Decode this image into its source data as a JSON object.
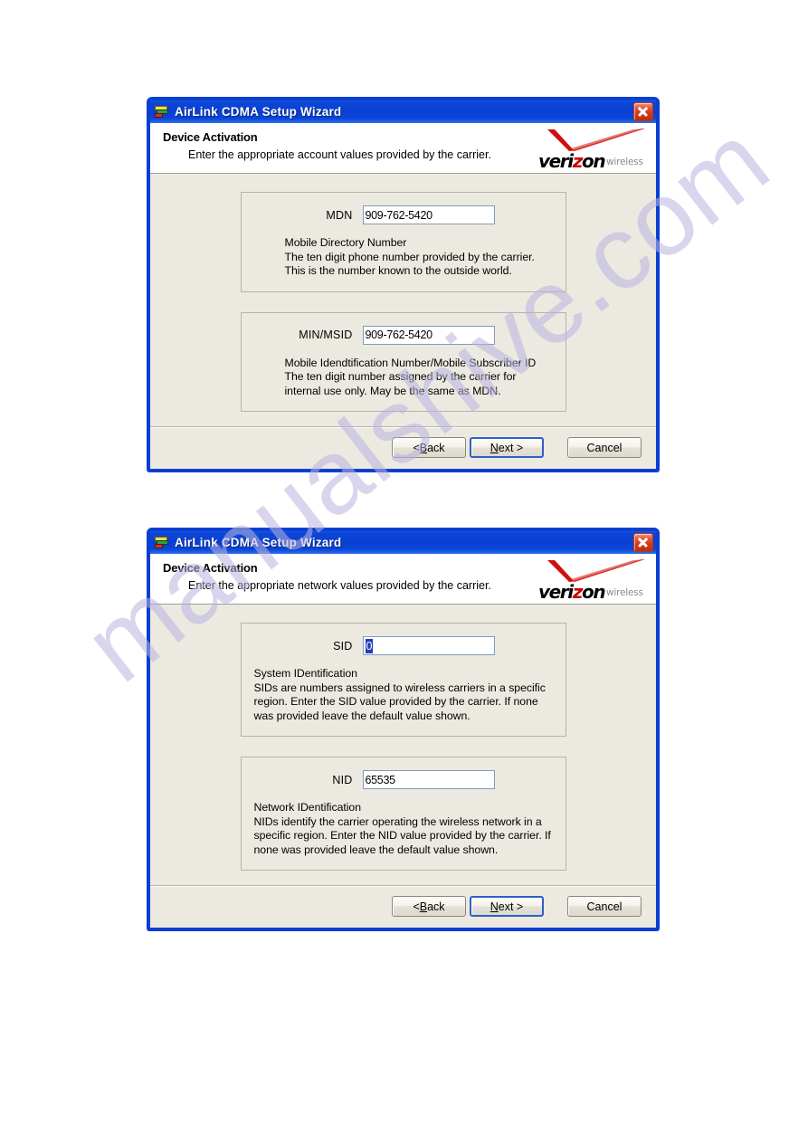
{
  "page": {
    "watermark": "manualshive.com",
    "watermark_color": "#b9b4e0",
    "background": "#ffffff"
  },
  "theme": {
    "titlebar_blue": "#0a3fd4",
    "body_beige": "#ece9e0",
    "header_white": "#ffffff",
    "input_border": "#7f9db9",
    "selection_blue": "#1f3fbd",
    "verizon_red": "#cc0000",
    "close_red": "#d03a18"
  },
  "dialogs": [
    {
      "id": "activation-account",
      "titlebar": {
        "icon": "airlink-app-icon",
        "title": "AirLink CDMA Setup Wizard",
        "close_label": "Close"
      },
      "header": {
        "title": "Device Activation",
        "subtitle": "Enter the appropriate account values provided by the carrier.",
        "logo": {
          "word": "veri",
          "accent": "z",
          "word_end": "on",
          "sub": "wireless",
          "icon": "verizon-check-icon"
        }
      },
      "groups": [
        {
          "label": "MDN",
          "value": "909-762-5420",
          "selected": false,
          "indent_desc": true,
          "description": "Mobile Directory Number\nThe ten digit phone number provided by the carrier.\nThis is the number known to the outside world."
        },
        {
          "label": "MIN/MSID",
          "value": "909-762-5420",
          "selected": false,
          "indent_desc": true,
          "description": "Mobile Idendtification Number/Mobile Subscriber ID\nThe ten digit number assigned by the carrier for\ninternal use only. May be the same as MDN."
        }
      ],
      "buttons": {
        "back": "< Back",
        "back_pre": "< ",
        "back_accel": "B",
        "back_post": "ack",
        "next_pre": "",
        "next_accel": "N",
        "next_post": "ext >",
        "cancel": "Cancel"
      }
    },
    {
      "id": "activation-network",
      "titlebar": {
        "icon": "airlink-app-icon",
        "title": "AirLink CDMA Setup Wizard",
        "close_label": "Close"
      },
      "header": {
        "title": "Device Activation",
        "subtitle": "Enter the appropriate network values provided by the carrier.",
        "logo": {
          "word": "veri",
          "accent": "z",
          "word_end": "on",
          "sub": "wireless",
          "icon": "verizon-check-icon"
        }
      },
      "groups": [
        {
          "label": "SID",
          "value": "0",
          "selected": true,
          "indent_desc": false,
          "description": "System IDentification\nSIDs are numbers assigned to wireless carriers in a specific\nregion. Enter the SID value provided by the carrier. If none\nwas provided leave the default value shown."
        },
        {
          "label": "NID",
          "value": "65535",
          "selected": false,
          "indent_desc": false,
          "description": "Network IDentification\nNIDs identify the carrier operating the wireless network in a\nspecific region. Enter the NID value provided by the carrier. If\nnone was provided leave the default value shown."
        }
      ],
      "buttons": {
        "back_pre": "< ",
        "back_accel": "B",
        "back_post": "ack",
        "next_pre": "",
        "next_accel": "N",
        "next_post": "ext >",
        "cancel": "Cancel"
      }
    }
  ]
}
